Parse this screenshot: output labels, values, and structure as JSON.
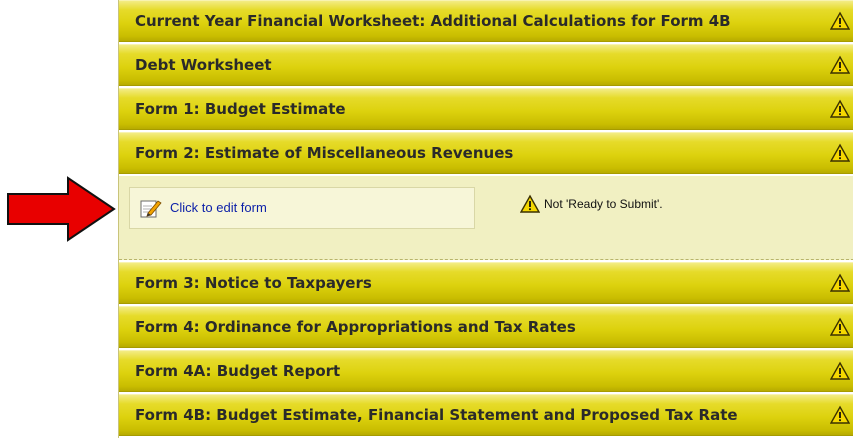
{
  "sections": [
    {
      "title": "Current Year Financial Worksheet: Additional Calculations for Form 4B"
    },
    {
      "title": "Debt Worksheet"
    },
    {
      "title": "Form 1: Budget Estimate"
    },
    {
      "title": "Form 2: Estimate of Miscellaneous Revenues"
    },
    {
      "title": "Form 3: Notice to Taxpayers"
    },
    {
      "title": "Form 4: Ordinance for Appropriations and Tax Rates"
    },
    {
      "title": "Form 4A: Budget Report"
    },
    {
      "title": "Form 4B: Budget Estimate, Financial Statement and Proposed Tax Rate"
    }
  ],
  "expanded": {
    "edit_link": "Click to edit form",
    "status_text": "Not 'Ready to Submit'."
  },
  "icons": {
    "warning": "warning-triangle-icon",
    "edit": "pencil-icon",
    "pointer": "red-arrow"
  },
  "colors": {
    "bar": "#ddd20e",
    "panel": "#f1f0c2",
    "link": "#0b1fa8",
    "arrow": "#e00000"
  }
}
